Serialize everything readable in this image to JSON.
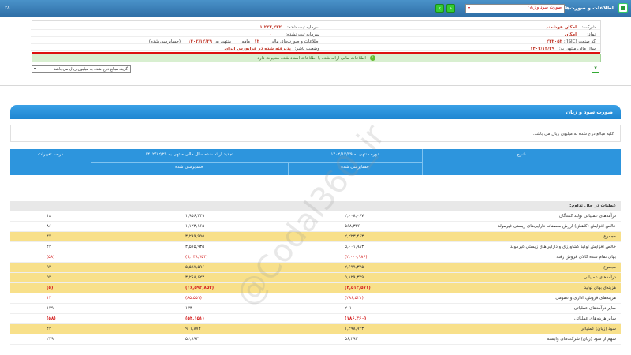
{
  "header": {
    "title": "اطلاعات و صورت‌های مالی",
    "select_value": "صورت سود و زیان",
    "code": "۴۸"
  },
  "info": {
    "company_label": "شرکت:",
    "company_value": "امکان هوشمند",
    "registered_capital_label": "سرمایه ثبت شده:",
    "registered_capital_value": "۱,۲۲۲,۲۲۲",
    "symbol_label": "نماد:",
    "symbol_value": "امکان",
    "unregistered_capital_label": "سرمایه ثبت نشده:",
    "unregistered_capital_value": "۰",
    "isic_label": "کد صنعت (ISIC):",
    "isic_value": "۲۴۲۰۵۲",
    "report_label": "اطلاعات و صورت‌های مالی",
    "months_value": "۱۲",
    "months_label": "ماهه",
    "period_end_label": "منتهی به",
    "period_end_value": "۱۴۰۲/۱۲/۲۹",
    "audit_status": "(حسابرسی شده)",
    "fiscal_year_label": "سال مالی منتهی به:",
    "fiscal_year_value": "۱۴۰۲/۱۲/۲۹",
    "status_label": "وضعیت ناشر:",
    "status_value": "پذیرفته شده در فرابورس ایران"
  },
  "message": "اطلاعات مالی ارائه شده با اطلاعات اسناد شده مغایرت دارد",
  "unit_dropdown": "گزینه مبالغ درج شده به میلیون ریال می باشد",
  "section": {
    "title": "صورت سود و زیان",
    "note": "کلیه مبالغ درج شده به میلیون ریال می باشد."
  },
  "table": {
    "headers": {
      "desc": "شرح",
      "period": "دوره منتهی به ۱۴۰۲/۱۲/۲۹",
      "prior": "تجدید ارائه شده سال مالی منتهی به ۱۴۰۲/۱۲/۲۹",
      "pct": "درصد تغییرات",
      "audited1": "حسابرسی شده",
      "audited2": "حسابرسی شده"
    },
    "rows": [
      {
        "style": "group",
        "desc": "عملیات در حال تداوم:",
        "v1": "",
        "v2": "",
        "pct": ""
      },
      {
        "style": "white",
        "desc": "درآمدهای عملیاتی تولید کنندگان",
        "v1": "۲,۰۰۸,۰۶۷",
        "v2": "۱,۹۵۶,۴۳۹",
        "pct": "۱۸"
      },
      {
        "style": "white",
        "desc": "خالص افزایش (کاهش) ارزش منصفانه دارایی‌های زیستی غیرمولد",
        "v1": "۵۶۸,۳۳۶",
        "v2": "۱,۱۲۳,۱۶۵",
        "pct": "۸۶"
      },
      {
        "style": "yellow",
        "desc": "مجموع",
        "v1": "۲,۲۲۳,۴۶۳",
        "v2": "۳,۲۹۹,۹۵۵",
        "pct": "۴۷"
      },
      {
        "style": "white",
        "desc": "خالص افزایش تولید کشاورزی و دارایی‌های زیستی غیرمولد",
        "v1": "۵,۰۰۱,۹۸۳",
        "v2": "۳,۵۷۵,۹۳۵",
        "pct": "۴۳"
      },
      {
        "style": "white",
        "desc": "بهای تمام شده کالای فروش رفته",
        "v1": "(۲,۰۰۰,۹۸۶)",
        "v2": "(۱,۰۴۸,۷۵۳)",
        "pct": "(۵۸)",
        "neg": true
      },
      {
        "style": "yellow",
        "desc": "مجموع",
        "v1": "۲,۶۹۹,۳۲۵",
        "v2": "۵,۵۸۷,۵۹۶",
        "pct": "۹۳"
      },
      {
        "style": "yellow",
        "desc": "درآمدهای عملیاتی",
        "v1": "۵,۱۲۹,۳۲۹",
        "v2": "۳,۲۶۸,۶۲۳",
        "pct": "۵۳"
      },
      {
        "style": "yellow",
        "desc": "هزینه‌ی بهای تولید",
        "v1": "(۴,۵۱۳,۵۷۱)",
        "v2": "(۱۶,۵۹۲,۸۵۳)",
        "pct": "(۵)",
        "neg": true,
        "bold": true
      },
      {
        "style": "white",
        "desc": "هزینه‌های فروش، اداری و عمومی",
        "v1": "(۲۸۶,۵۲۱)",
        "v2": "(۸۵,۵۵۱)",
        "pct": "۱۳",
        "neg": true
      },
      {
        "style": "white",
        "desc": "سایر درآمدهای عملیاتی",
        "v1": "۲۰۱",
        "v2": "۱۳۴",
        "pct": "۱۲۹"
      },
      {
        "style": "white",
        "desc": "سایر هزینه‌های عملیاتی",
        "v1": "(۱۸۶,۳۶۰)",
        "v2": "(۵۴,۱۵۱)",
        "pct": "(۵۸)",
        "neg": true,
        "bold": true
      },
      {
        "style": "yellow",
        "desc": "سود (زیان) عملیاتی",
        "v1": "۱,۲۹۸,۹۴۳",
        "v2": "۹۱۱,۸۷۳",
        "pct": "۴۳"
      },
      {
        "style": "white",
        "desc": "سهم از سود (زیان) شرکت‌های وابسته",
        "v1": "۵۶,۲۹۳",
        "v2": "۵۶,۸۹۳",
        "pct": "۲۲۹"
      }
    ]
  },
  "watermark": "@Codal360_ir"
}
